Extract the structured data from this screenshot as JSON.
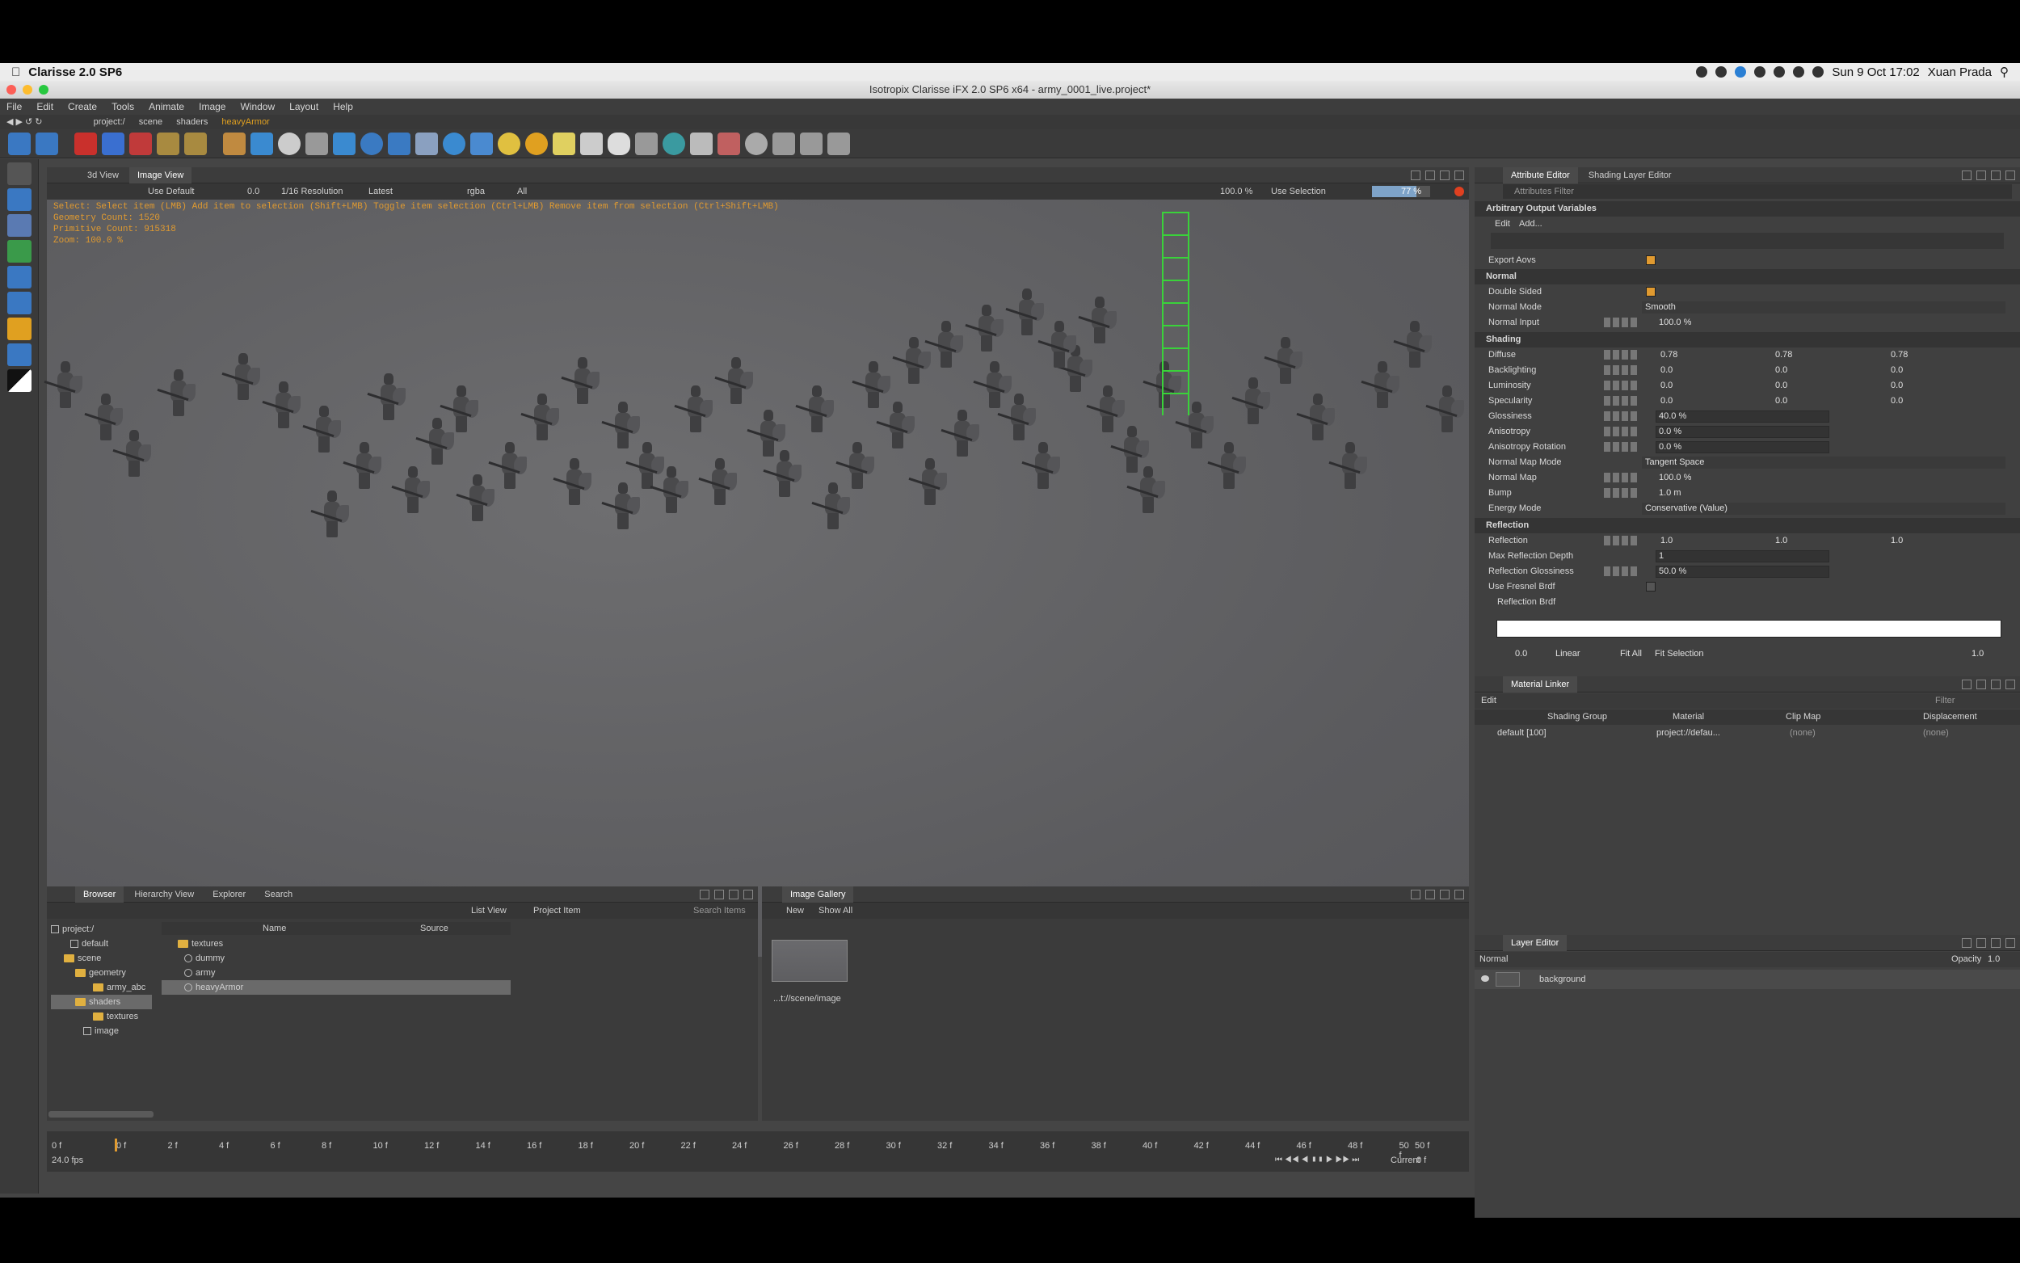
{
  "mac": {
    "app": "Clarisse 2.0 SP6",
    "datetime": "Sun 9 Oct 17:02",
    "user": "Xuan Prada"
  },
  "window": {
    "title": "Isotropix Clarisse iFX 2.0 SP6 x64 - army_0001_live.project*"
  },
  "menu": [
    "File",
    "Edit",
    "Create",
    "Tools",
    "Animate",
    "Image",
    "Window",
    "Layout",
    "Help"
  ],
  "path": [
    "project:/",
    "scene",
    "shaders",
    "heavyArmor"
  ],
  "viewport": {
    "tabs": [
      "3d View",
      "Image View"
    ],
    "display": "Use Default",
    "exposure": "0.0",
    "resolution": "1/16 Resolution",
    "layer": "Latest",
    "channel": "rgba",
    "all": "All",
    "zoom": "100.0 %",
    "selection": "Use Selection",
    "progress": "77 %",
    "overlay_hint": "Select: Select item (LMB)  Add item to selection (Shift+LMB)  Toggle item selection (Ctrl+LMB)  Remove item from selection (Ctrl+Shift+LMB)",
    "geo_count": "Geometry Count: 1520",
    "prim_count": "Primitive Count: 915318",
    "zoom_overlay": "Zoom: 100.0 %"
  },
  "attr": {
    "tabs": [
      "Attribute Editor",
      "Shading Layer Editor"
    ],
    "filter": "Attributes Filter",
    "aov_section": "Arbitrary Output Variables",
    "edit": "Edit",
    "add": "Add...",
    "export_aovs": "Export Aovs",
    "normal_section": "Normal",
    "double_sided": "Double Sided",
    "normal_mode": "Normal Mode",
    "normal_mode_val": "Smooth",
    "normal_input": "Normal Input",
    "normal_input_val": "100.0 %",
    "shading_section": "Shading",
    "diffuse": "Diffuse",
    "diffuse_r": "0.78",
    "diffuse_g": "0.78",
    "diffuse_b": "0.78",
    "backlighting": "Backlighting",
    "luminosity": "Luminosity",
    "specularity": "Specularity",
    "zero": "0.0",
    "glossiness": "Glossiness",
    "glossiness_val": "40.0 %",
    "anisotropy": "Anisotropy",
    "anisotropy_val": "0.0 %",
    "aniso_rot": "Anisotropy Rotation",
    "aniso_rot_val": "0.0 %",
    "nmap_mode": "Normal Map Mode",
    "nmap_mode_val": "Tangent Space",
    "nmap": "Normal Map",
    "nmap_val": "100.0 %",
    "bump": "Bump",
    "bump_val": "1.0 m",
    "energy": "Energy Mode",
    "energy_val": "Conservative (Value)",
    "refl_section": "Reflection",
    "reflection": "Reflection",
    "refl_val": "1.0",
    "max_depth": "Max Reflection Depth",
    "max_depth_val": "1",
    "refl_gloss": "Reflection Glossiness",
    "refl_gloss_val": "50.0 %",
    "fresnel": "Use Fresnel Brdf",
    "refl_brdf": "Reflection Brdf",
    "curve_min": "0.0",
    "interp": "Linear",
    "fit_all": "Fit All",
    "fit_sel": "Fit Selection",
    "curve_max": "1.0"
  },
  "linker": {
    "title": "Material Linker",
    "edit": "Edit",
    "filter": "Filter",
    "cols": [
      "Shading Group",
      "Material",
      "Clip Map",
      "Displacement"
    ],
    "row": [
      "default [100]",
      "project://defau...",
      "(none)",
      "(none)"
    ]
  },
  "layer": {
    "title": "Layer Editor",
    "mode": "Normal",
    "opacity": "Opacity",
    "opacity_val": "1.0",
    "item": "background"
  },
  "browser": {
    "tabs": [
      "Browser",
      "Hierarchy View",
      "Explorer",
      "Search"
    ],
    "view": "List View",
    "type": "Project Item",
    "search": "Search Items",
    "tree": [
      "project:/",
      "default",
      "scene",
      "geometry",
      "army_abc",
      "shaders",
      "textures",
      "image"
    ],
    "cols": [
      "Name",
      "Source"
    ],
    "items": [
      "textures",
      "dummy",
      "army",
      "heavyArmor"
    ]
  },
  "gallery": {
    "title": "Image Gallery",
    "new": "New",
    "show": "Show All",
    "caption": "...t://scene/image"
  },
  "timeline": {
    "start": "0 f",
    "end": "50 f",
    "fps": "24.0 fps",
    "current_label": "Current",
    "current": "0 f",
    "ticks": [
      "0 f",
      "2 f",
      "4 f",
      "6 f",
      "8 f",
      "10 f",
      "12 f",
      "14 f",
      "16 f",
      "18 f",
      "20 f",
      "22 f",
      "24 f",
      "26 f",
      "28 f",
      "30 f",
      "32 f",
      "34 f",
      "36 f",
      "38 f",
      "40 f",
      "42 f",
      "44 f",
      "46 f",
      "48 f",
      "50 f"
    ]
  }
}
